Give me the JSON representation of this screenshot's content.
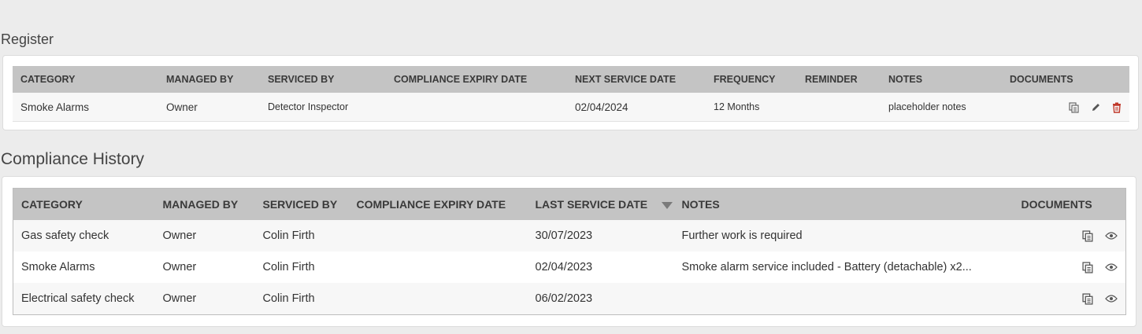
{
  "register": {
    "title": "Register",
    "headers": {
      "category": "CATEGORY",
      "managed_by": "MANAGED BY",
      "serviced_by": "SERVICED BY",
      "compliance_expiry_date": "COMPLIANCE EXPIRY DATE",
      "next_service_date": "NEXT SERVICE DATE",
      "frequency": "FREQUENCY",
      "reminder": "REMINDER",
      "notes": "NOTES",
      "documents": "DOCUMENTS"
    },
    "rows": [
      {
        "category": "Smoke Alarms",
        "managed_by": "Owner",
        "serviced_by": "Detector Inspector",
        "compliance_expiry_date": "",
        "next_service_date": "02/04/2024",
        "frequency": "12 Months",
        "reminder": "",
        "notes": "placeholder notes",
        "actions": [
          "copy-icon",
          "edit-icon",
          "delete-icon"
        ]
      }
    ]
  },
  "history": {
    "title": "Compliance History",
    "headers": {
      "category": "CATEGORY",
      "managed_by": "MANAGED BY",
      "serviced_by": "SERVICED BY",
      "compliance_expiry_date": "COMPLIANCE EXPIRY DATE",
      "last_service_date": "LAST SERVICE DATE",
      "notes": "NOTES",
      "documents": "DOCUMENTS"
    },
    "sort": {
      "column": "last_service_date",
      "direction": "descending",
      "icon": "sort-down-icon"
    },
    "rows": [
      {
        "category": "Gas safety check",
        "managed_by": "Owner",
        "serviced_by": "Colin Firth",
        "compliance_expiry_date": "",
        "last_service_date": "30/07/2023",
        "notes": "Further work is required",
        "actions": [
          "copy-icon",
          "view-icon"
        ]
      },
      {
        "category": "Smoke Alarms",
        "managed_by": "Owner",
        "serviced_by": "Colin Firth",
        "compliance_expiry_date": "",
        "last_service_date": "02/04/2023",
        "notes": "Smoke alarm service included - Battery (detachable) x2...",
        "actions": [
          "copy-icon",
          "view-icon"
        ]
      },
      {
        "category": "Electrical safety check",
        "managed_by": "Owner",
        "serviced_by": "Colin Firth",
        "compliance_expiry_date": "",
        "last_service_date": "06/02/2023",
        "notes": "",
        "actions": [
          "copy-icon",
          "view-icon"
        ]
      }
    ]
  },
  "colors": {
    "page_background": "#ececec",
    "header_background": "#c4c4c4",
    "delete_icon": "#c0392b",
    "icon_gray": "#555555"
  }
}
